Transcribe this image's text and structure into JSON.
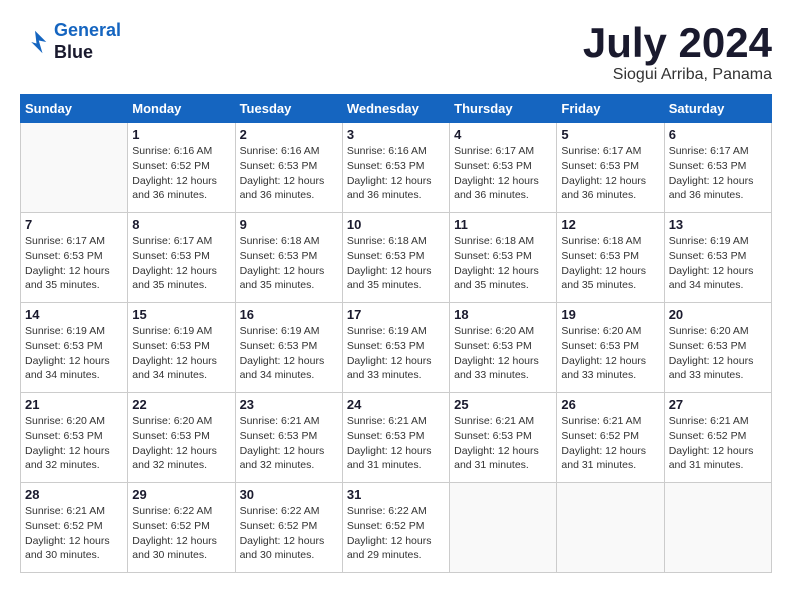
{
  "header": {
    "logo_line1": "General",
    "logo_line2": "Blue",
    "month_year": "July 2024",
    "location": "Siogui Arriba, Panama"
  },
  "days_of_week": [
    "Sunday",
    "Monday",
    "Tuesday",
    "Wednesday",
    "Thursday",
    "Friday",
    "Saturday"
  ],
  "weeks": [
    [
      {
        "num": "",
        "info": ""
      },
      {
        "num": "1",
        "info": "Sunrise: 6:16 AM\nSunset: 6:52 PM\nDaylight: 12 hours\nand 36 minutes."
      },
      {
        "num": "2",
        "info": "Sunrise: 6:16 AM\nSunset: 6:53 PM\nDaylight: 12 hours\nand 36 minutes."
      },
      {
        "num": "3",
        "info": "Sunrise: 6:16 AM\nSunset: 6:53 PM\nDaylight: 12 hours\nand 36 minutes."
      },
      {
        "num": "4",
        "info": "Sunrise: 6:17 AM\nSunset: 6:53 PM\nDaylight: 12 hours\nand 36 minutes."
      },
      {
        "num": "5",
        "info": "Sunrise: 6:17 AM\nSunset: 6:53 PM\nDaylight: 12 hours\nand 36 minutes."
      },
      {
        "num": "6",
        "info": "Sunrise: 6:17 AM\nSunset: 6:53 PM\nDaylight: 12 hours\nand 36 minutes."
      }
    ],
    [
      {
        "num": "7",
        "info": "Sunrise: 6:17 AM\nSunset: 6:53 PM\nDaylight: 12 hours\nand 35 minutes."
      },
      {
        "num": "8",
        "info": "Sunrise: 6:17 AM\nSunset: 6:53 PM\nDaylight: 12 hours\nand 35 minutes."
      },
      {
        "num": "9",
        "info": "Sunrise: 6:18 AM\nSunset: 6:53 PM\nDaylight: 12 hours\nand 35 minutes."
      },
      {
        "num": "10",
        "info": "Sunrise: 6:18 AM\nSunset: 6:53 PM\nDaylight: 12 hours\nand 35 minutes."
      },
      {
        "num": "11",
        "info": "Sunrise: 6:18 AM\nSunset: 6:53 PM\nDaylight: 12 hours\nand 35 minutes."
      },
      {
        "num": "12",
        "info": "Sunrise: 6:18 AM\nSunset: 6:53 PM\nDaylight: 12 hours\nand 35 minutes."
      },
      {
        "num": "13",
        "info": "Sunrise: 6:19 AM\nSunset: 6:53 PM\nDaylight: 12 hours\nand 34 minutes."
      }
    ],
    [
      {
        "num": "14",
        "info": "Sunrise: 6:19 AM\nSunset: 6:53 PM\nDaylight: 12 hours\nand 34 minutes."
      },
      {
        "num": "15",
        "info": "Sunrise: 6:19 AM\nSunset: 6:53 PM\nDaylight: 12 hours\nand 34 minutes."
      },
      {
        "num": "16",
        "info": "Sunrise: 6:19 AM\nSunset: 6:53 PM\nDaylight: 12 hours\nand 34 minutes."
      },
      {
        "num": "17",
        "info": "Sunrise: 6:19 AM\nSunset: 6:53 PM\nDaylight: 12 hours\nand 33 minutes."
      },
      {
        "num": "18",
        "info": "Sunrise: 6:20 AM\nSunset: 6:53 PM\nDaylight: 12 hours\nand 33 minutes."
      },
      {
        "num": "19",
        "info": "Sunrise: 6:20 AM\nSunset: 6:53 PM\nDaylight: 12 hours\nand 33 minutes."
      },
      {
        "num": "20",
        "info": "Sunrise: 6:20 AM\nSunset: 6:53 PM\nDaylight: 12 hours\nand 33 minutes."
      }
    ],
    [
      {
        "num": "21",
        "info": "Sunrise: 6:20 AM\nSunset: 6:53 PM\nDaylight: 12 hours\nand 32 minutes."
      },
      {
        "num": "22",
        "info": "Sunrise: 6:20 AM\nSunset: 6:53 PM\nDaylight: 12 hours\nand 32 minutes."
      },
      {
        "num": "23",
        "info": "Sunrise: 6:21 AM\nSunset: 6:53 PM\nDaylight: 12 hours\nand 32 minutes."
      },
      {
        "num": "24",
        "info": "Sunrise: 6:21 AM\nSunset: 6:53 PM\nDaylight: 12 hours\nand 31 minutes."
      },
      {
        "num": "25",
        "info": "Sunrise: 6:21 AM\nSunset: 6:53 PM\nDaylight: 12 hours\nand 31 minutes."
      },
      {
        "num": "26",
        "info": "Sunrise: 6:21 AM\nSunset: 6:52 PM\nDaylight: 12 hours\nand 31 minutes."
      },
      {
        "num": "27",
        "info": "Sunrise: 6:21 AM\nSunset: 6:52 PM\nDaylight: 12 hours\nand 31 minutes."
      }
    ],
    [
      {
        "num": "28",
        "info": "Sunrise: 6:21 AM\nSunset: 6:52 PM\nDaylight: 12 hours\nand 30 minutes."
      },
      {
        "num": "29",
        "info": "Sunrise: 6:22 AM\nSunset: 6:52 PM\nDaylight: 12 hours\nand 30 minutes."
      },
      {
        "num": "30",
        "info": "Sunrise: 6:22 AM\nSunset: 6:52 PM\nDaylight: 12 hours\nand 30 minutes."
      },
      {
        "num": "31",
        "info": "Sunrise: 6:22 AM\nSunset: 6:52 PM\nDaylight: 12 hours\nand 29 minutes."
      },
      {
        "num": "",
        "info": ""
      },
      {
        "num": "",
        "info": ""
      },
      {
        "num": "",
        "info": ""
      }
    ]
  ]
}
